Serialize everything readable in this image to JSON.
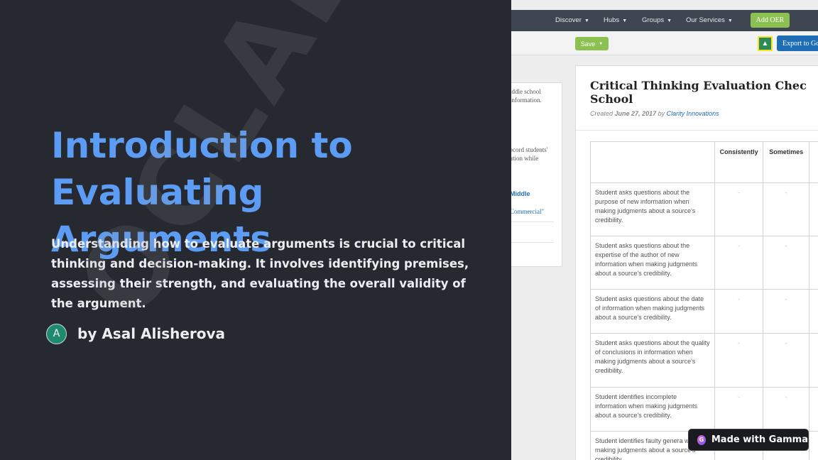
{
  "slide": {
    "title": "Introduction to Evaluating Arguments",
    "description": "Understanding how to evaluate arguments is crucial to critical thinking and decision-making. It involves identifying premises, assessing their strength, and evaluating the overall validity of the argument.",
    "author_initial": "A",
    "byline": "by Asal Alisherova",
    "title_color": "#5d9cf5",
    "background": "#262930"
  },
  "site": {
    "nav": [
      "Discover",
      "Hubs",
      "Groups",
      "Our Services"
    ],
    "add_oer_label": "Add OER",
    "save_label": "Save",
    "export_label": "Export to Go",
    "side_lines": [
      "iddle school",
      "information.",
      "ecord students'",
      "ation while"
    ],
    "side_link_middle": "Middle",
    "side_link_commercial": "Commercial\"",
    "doc_title_line1": "Critical Thinking Evaluation Chec",
    "doc_title_line2": "School",
    "created_prefix": "Created",
    "created_date": "June 27, 2017",
    "created_by": "by",
    "org": "Clarity Innovations",
    "accent_green": "#8cc152",
    "accent_blue": "#1f6db5",
    "table": {
      "headers": [
        "",
        "Consistently",
        "Sometimes"
      ],
      "rows": [
        "Student asks questions about the purpose of new information when making judgments about a source's credibility.",
        "Student asks questions about the expertise of the author of new information when making judgments about a source's credibility.",
        "Student asks questions about the date of information when making judgments about a source's credibility.",
        "Student asks questions about the quality of conclusions in information when making judgments about a source's credibility.",
        "Student identifies incomplete information when making judgments about a source's credibility.",
        "Student identifies faulty genera when making judgments about a source's credibility."
      ],
      "mark": "-"
    }
  },
  "watermark": "OCLAB.U",
  "badge": {
    "icon": "gamma-logo-icon",
    "label": "Made with Gamma"
  }
}
